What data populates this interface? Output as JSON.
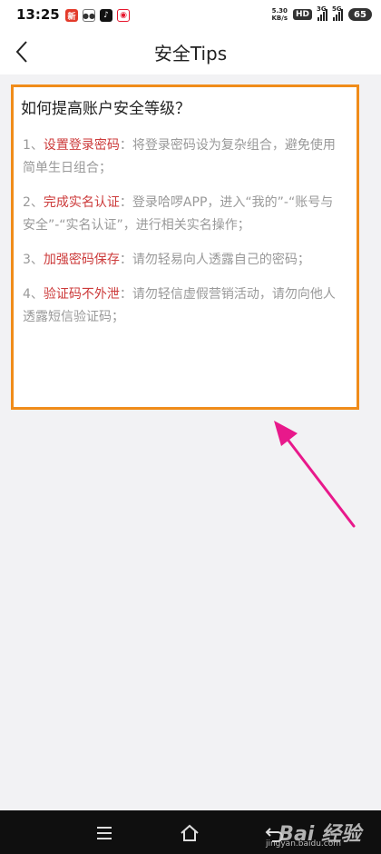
{
  "status_bar": {
    "time": "13:25",
    "apps": [
      "news-app",
      "wechat-app",
      "tiktok-app",
      "weibo-app"
    ],
    "net_speed_value": "5.30",
    "net_speed_unit": "KB/s",
    "hd_label": "HD",
    "signal_1": "3G",
    "signal_2": "5G",
    "battery": "65"
  },
  "header": {
    "title": "安全Tips"
  },
  "card": {
    "heading": "如何提高账户安全等级？",
    "tips": [
      {
        "prefix": "1、",
        "highlight": "设置登录密码",
        "text": "：将登录密码设为复杂组合，避免使用简单生日组合；"
      },
      {
        "prefix": "2、",
        "highlight": "完成实名认证",
        "text": "：登录哈啰APP，进入“我的”-“账号与安全”-“实名认证”，进行相关实名操作；"
      },
      {
        "prefix": "3、",
        "highlight": "加强密码保存",
        "text": "：请勿轻易向人透露自己的密码；"
      },
      {
        "prefix": "4、",
        "highlight": "验证码不外泄",
        "text": "：请勿轻信虚假营销活动，请勿向他人透露短信验证码；"
      }
    ]
  },
  "watermark": {
    "logo": "Bai 经验",
    "url": "jingyan.baidu.com"
  },
  "colors": {
    "card_border": "#f08c1a",
    "highlight": "#cc3a3a",
    "arrow": "#e8198b"
  }
}
